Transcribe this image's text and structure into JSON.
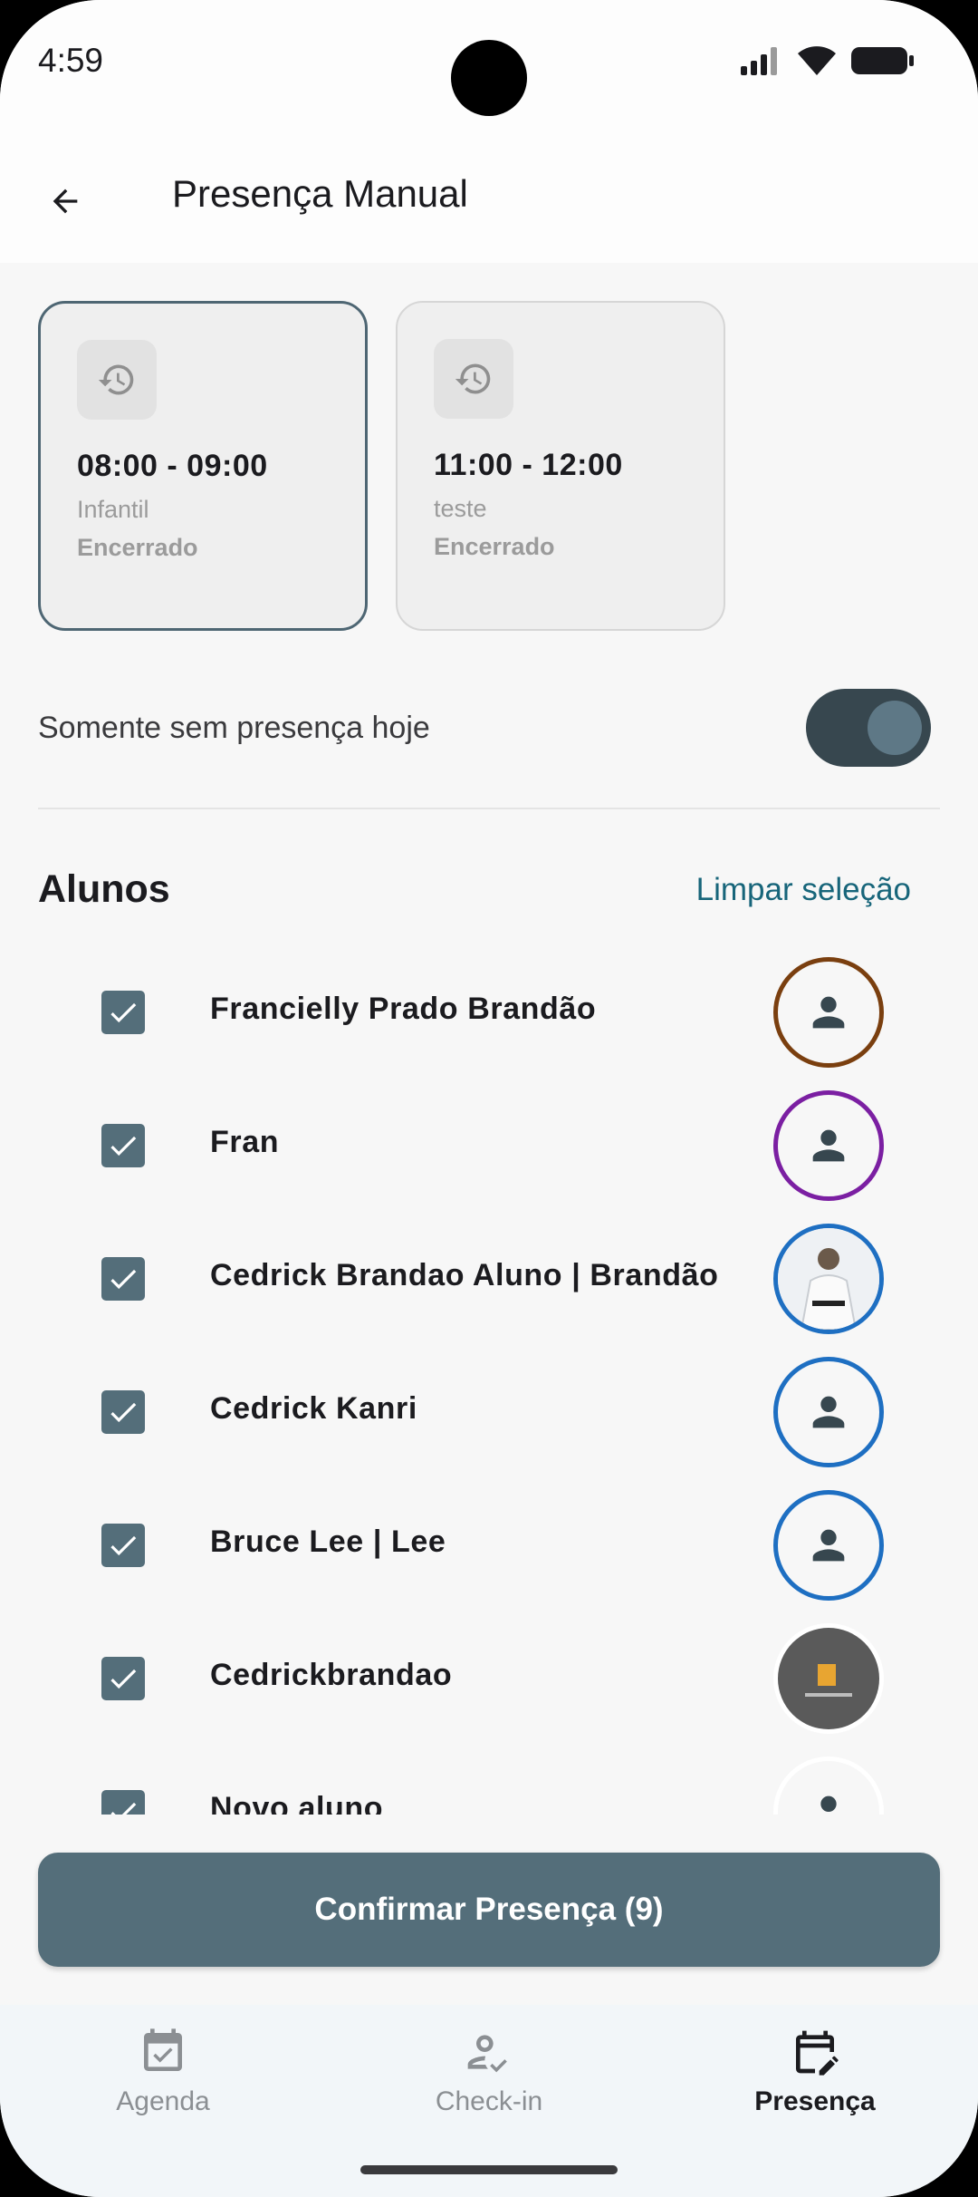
{
  "status_bar": {
    "time": "4:59"
  },
  "app_bar": {
    "title": "Presença Manual"
  },
  "class_slots": [
    {
      "time": "08:00 - 09:00",
      "name": "Infantil",
      "status": "Encerrado",
      "selected": true
    },
    {
      "time": "11:00 - 12:00",
      "name": "teste",
      "status": "Encerrado",
      "selected": false
    }
  ],
  "filter": {
    "label": "Somente sem presença hoje",
    "enabled": true
  },
  "students_section": {
    "title": "Alunos",
    "clear_label": "Limpar seleção"
  },
  "students": [
    {
      "name": "Francielly Prado Brandão",
      "checked": true,
      "avatar": "person-icon",
      "ring_color": "#7a3f0f"
    },
    {
      "name": "Fran",
      "checked": true,
      "avatar": "person-icon",
      "ring_color": "#7b1fa2"
    },
    {
      "name": "Cedrick Brandao Aluno | Brandão",
      "checked": true,
      "avatar": "photo",
      "ring_color": "#1e6fc2"
    },
    {
      "name": "Cedrick Kanri",
      "checked": true,
      "avatar": "person-icon",
      "ring_color": "#1e6fc2"
    },
    {
      "name": "Bruce Lee | Lee",
      "checked": true,
      "avatar": "person-icon",
      "ring_color": "#1e6fc2"
    },
    {
      "name": "Cedrickbrandao",
      "checked": true,
      "avatar": "photo",
      "ring_color": "#ffffff"
    },
    {
      "name": "Novo aluno",
      "checked": true,
      "avatar": "person-icon",
      "ring_color": "#ffffff"
    }
  ],
  "confirm_button": {
    "label": "Confirmar Presença (9)"
  },
  "bottom_nav": [
    {
      "label": "Agenda",
      "icon": "calendar-check-icon",
      "active": false
    },
    {
      "label": "Check-in",
      "icon": "person-check-icon",
      "active": false
    },
    {
      "label": "Presença",
      "icon": "calendar-edit-icon",
      "active": true
    }
  ],
  "colors": {
    "primary": "#546e7a",
    "accent_link": "#17657a",
    "toggle_track": "#37474f"
  }
}
